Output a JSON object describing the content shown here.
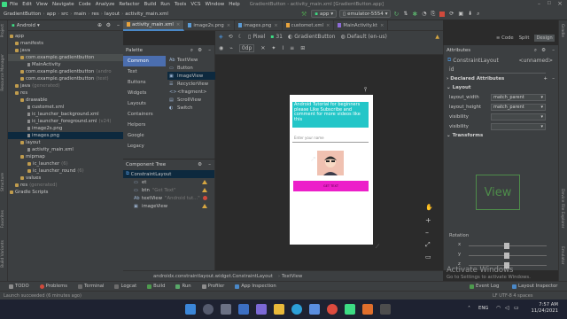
{
  "colors": {
    "accent": "#4a88c7",
    "textview_bg": "#23c6c8",
    "button_bg": "#ec1fc9",
    "image_bg": "#f0c1b1",
    "warning": "#d6a641",
    "error": "#d04a3c"
  },
  "window": {
    "title": "GradientButton - activity_main.xml [GradientButton.app]"
  },
  "menu": [
    "File",
    "Edit",
    "View",
    "Navigate",
    "Code",
    "Analyze",
    "Refactor",
    "Build",
    "Run",
    "Tools",
    "VCS",
    "Window",
    "Help"
  ],
  "breadcrumbs": [
    "GradientButton",
    "app",
    "src",
    "main",
    "res",
    "layout",
    "activity_main.xml"
  ],
  "run": {
    "module": "app",
    "device": "emulator-5554"
  },
  "project_panel": {
    "view_mode": "Android",
    "items": [
      {
        "label": "app",
        "type": "folder"
      },
      {
        "label": "manifests",
        "type": "folder"
      },
      {
        "label": "java",
        "type": "folder"
      },
      {
        "label": "com.example.gradientbutton",
        "type": "folder",
        "highlight": true
      },
      {
        "label": "MainActivity",
        "type": "file"
      },
      {
        "label": "com.example.gradientbutton",
        "type": "folder",
        "hint": "(andro"
      },
      {
        "label": "com.example.gradientbutton",
        "type": "folder",
        "hint": "(test)"
      },
      {
        "label": "java",
        "type": "folder",
        "hint": "(generated)"
      },
      {
        "label": "res",
        "type": "folder"
      },
      {
        "label": "drawable",
        "type": "folder"
      },
      {
        "label": "customet.xml",
        "type": "file"
      },
      {
        "label": "ic_launcher_background.xml",
        "type": "file"
      },
      {
        "label": "ic_launcher_foreground.xml",
        "type": "file",
        "hint": "(v24)"
      },
      {
        "label": "image2s.png",
        "type": "file"
      },
      {
        "label": "images.png",
        "type": "file",
        "selected": true
      },
      {
        "label": "layout",
        "type": "folder"
      },
      {
        "label": "activity_main.xml",
        "type": "file"
      },
      {
        "label": "mipmap",
        "type": "folder"
      },
      {
        "label": "ic_launcher",
        "type": "folder",
        "hint": "(6)"
      },
      {
        "label": "ic_launcher_round",
        "type": "folder",
        "hint": "(6)"
      },
      {
        "label": "values",
        "type": "folder"
      },
      {
        "label": "res",
        "type": "folder",
        "hint": "(generated)"
      },
      {
        "label": "Gradle Scripts",
        "type": "folder"
      }
    ]
  },
  "editor_tabs": [
    {
      "label": "activity_main.xml",
      "active": true
    },
    {
      "label": "image2s.png"
    },
    {
      "label": "images.png"
    },
    {
      "label": "customet.xml"
    },
    {
      "label": "MainActivity.kt"
    }
  ],
  "view_modes": [
    "Code",
    "Split",
    "Design"
  ],
  "palette": {
    "title": "Palette",
    "categories": [
      "Common",
      "Text",
      "Buttons",
      "Widgets",
      "Layouts",
      "Containers",
      "Helpers",
      "Google",
      "Legacy"
    ],
    "items": [
      "TextView",
      "Button",
      "ImageView",
      "RecyclerView",
      "<fragment>",
      "ScrollView",
      "Switch"
    ]
  },
  "design_toolbar": {
    "device": "Pixel",
    "api": "31",
    "theme": "GradientButton",
    "locale": "Default (en-us)",
    "zoom_label": "0dp"
  },
  "component_tree": {
    "title": "Component Tree",
    "root": "ConstraintLayout",
    "items": [
      {
        "label": "et",
        "hint": "",
        "status": "warn"
      },
      {
        "label": "btn",
        "hint": "\"Get Text\"",
        "status": "warn"
      },
      {
        "label": "textView",
        "hint": "\"Android tut...\"",
        "status": "error"
      },
      {
        "label": "imageView",
        "hint": "",
        "status": "warn"
      }
    ]
  },
  "phone": {
    "textview_text": "Android Tutorial for beginners please Like Subscribe and comment for more videos like this",
    "edittext_hint": "Enter your name",
    "button_text": "GET TEXT"
  },
  "attributes": {
    "title": "Attributes",
    "widget": "ConstraintLayout",
    "id_value": "<unnamed>",
    "id_label": "id",
    "declared_header": "Declared Attributes",
    "layout_header": "Layout",
    "layout_rows": [
      {
        "name": "layout_width",
        "value": "match_parent"
      },
      {
        "name": "layout_height",
        "value": "match_parent"
      },
      {
        "name": "visibility",
        "value": ""
      },
      {
        "name": "visibility",
        "value": ""
      }
    ],
    "transforms_header": "Transforms",
    "view_label": "View",
    "rotation_label": "Rotation",
    "axes": [
      "x",
      "y",
      "z"
    ]
  },
  "status_path": "androidx.constraintlayout.widget.ConstraintLayout",
  "status_path_leaf": "TextView",
  "bottom_tabs": [
    "TODO",
    "Problems",
    "Terminal",
    "Logcat",
    "Build",
    "Run",
    "Profiler",
    "App Inspection"
  ],
  "bottom_right": {
    "event_log": "Event Log",
    "layout_inspector": "Layout Inspector"
  },
  "status_bar": {
    "message": "Launch succeeded (6 minutes ago)",
    "encoding": "LF  UTF-8  4 spaces"
  },
  "activate": {
    "title": "Activate Windows",
    "subtitle": "Go to Settings to activate Windows."
  },
  "taskbar": {
    "language": "ENG",
    "time": "7:57 AM",
    "date": "11/24/2021"
  },
  "left_strip_tabs": [
    "Project",
    "Resource Manager",
    "Structure",
    "Favorites",
    "Build Variants"
  ],
  "right_strip_tabs": [
    "Gradle",
    "Device File Explorer",
    "Emulator"
  ]
}
